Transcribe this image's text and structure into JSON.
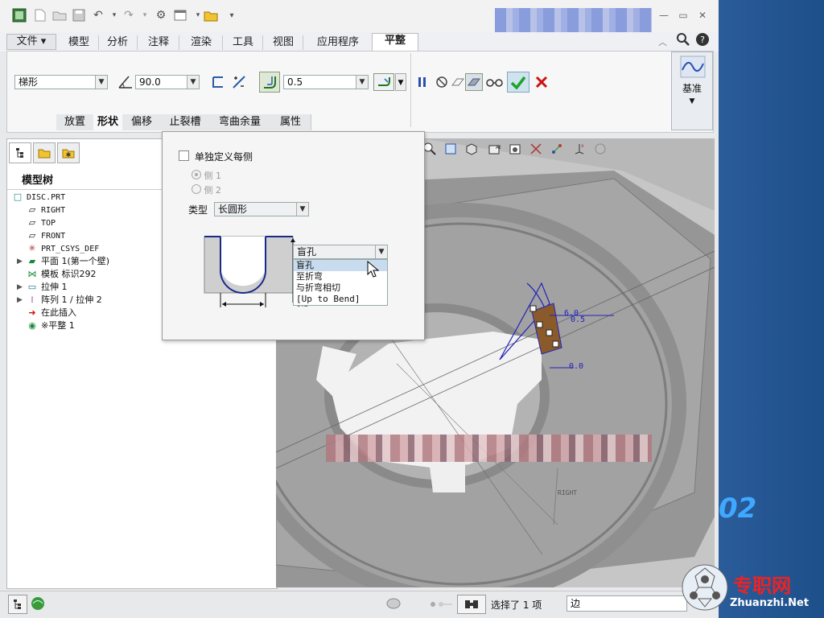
{
  "menus": {
    "file": "文件",
    "model": "模型",
    "analysis": "分析",
    "annotate": "注释",
    "render": "渲染",
    "tools": "工具",
    "view": "视图",
    "apps": "应用程序",
    "flatten": "平整"
  },
  "ribbon": {
    "shape_value": "梯形",
    "angle_value": "90.0",
    "offset_value": "0.5",
    "datum_label": "基准"
  },
  "subtabs": [
    "放置",
    "形状",
    "偏移",
    "止裂槽",
    "弯曲余量",
    "属性"
  ],
  "panel": {
    "define_each_side": "单独定义每侧",
    "side1": "侧 1",
    "side2": "侧 2",
    "type_label": "类型",
    "type_value": "长圆形",
    "depth_value": "盲孔",
    "hidden_value": "0.5",
    "options": [
      "盲孔",
      "至折弯",
      "与折弯相切",
      "[Up to Bend]"
    ]
  },
  "tree": {
    "title": "模型树",
    "nodes": [
      {
        "icon": "□",
        "label": "DISC.PRT"
      },
      {
        "icon": "▱",
        "label": "RIGHT"
      },
      {
        "icon": "▱",
        "label": "TOP"
      },
      {
        "icon": "▱",
        "label": "FRONT"
      },
      {
        "icon": "✳",
        "label": "PRT_CSYS_DEF"
      },
      {
        "icon": "▰",
        "label": "平面 1(第一个壁)"
      },
      {
        "icon": "⋈",
        "label": "模板 标识292"
      },
      {
        "icon": "▭",
        "label": "拉伸 1"
      },
      {
        "icon": "⁞",
        "label": "阵列 1 / 拉伸 2"
      },
      {
        "icon": "➜",
        "label": "在此插入"
      },
      {
        "icon": "◉",
        "label": "※平整 1"
      }
    ]
  },
  "status": {
    "selected_text": "选择了 1 项",
    "filter_value": "边"
  },
  "viewport_labels": {
    "dim_60": "6.0",
    "dim_05": "0.5",
    "dim_00": "0.0",
    "right": "RIGHT"
  },
  "brand": {
    "logo_text": "专职网",
    "url": "Zhuanzhi.Net",
    "big_number": "02"
  },
  "colors": {
    "accept": "#1aa52c",
    "cancel": "#cc1111",
    "pause": "#2a4fb0",
    "sketch": "#2222bb"
  }
}
